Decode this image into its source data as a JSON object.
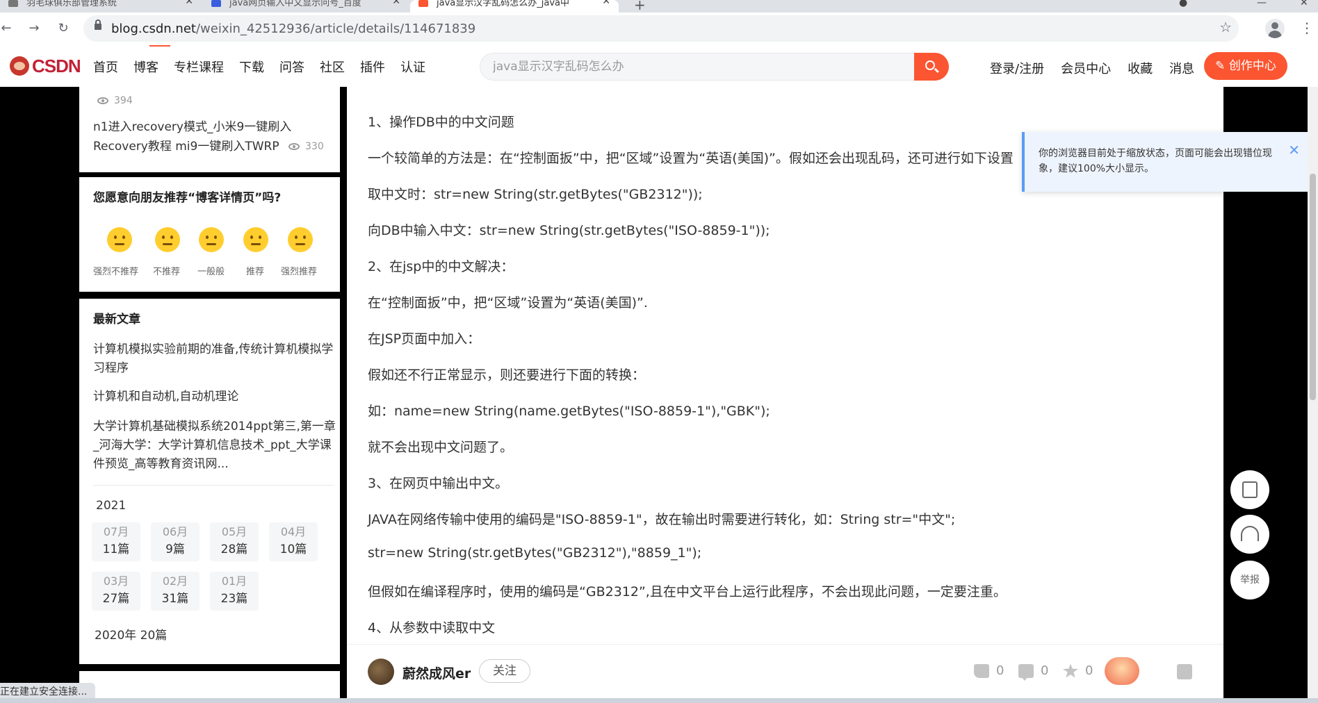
{
  "browser": {
    "tabs": [
      {
        "title": "羽毛球俱乐部管理系统",
        "color": "#5f6368"
      },
      {
        "title": "java网页输入中文显示问号_百度",
        "color": "#3a5de0"
      },
      {
        "title": "java显示汉字乱码怎么办_java中",
        "color": "#fc5531"
      }
    ],
    "url_domain": "blog.csdn.net",
    "url_path": "/weixin_42512936/article/details/114671839"
  },
  "header": {
    "logo": "CSDN",
    "nav": [
      "首页",
      "博客",
      "专栏课程",
      "下载",
      "问答",
      "社区",
      "插件",
      "认证"
    ],
    "search_placeholder": "java显示汉字乱码怎么办",
    "right_nav": [
      "登录/注册",
      "会员中心",
      "收藏",
      "消息"
    ],
    "create_label": "创作中心"
  },
  "sidebar": {
    "top_card": {
      "views_1": "394",
      "link_2": "n1进入recovery模式_小米9一键刷入Recovery教程 mi9一键刷入TWRP",
      "views_2": "330"
    },
    "rating": {
      "question": "您愿意向朋友推荐“博客详情页”吗?",
      "options": [
        "强烈不推荐",
        "不推荐",
        "一般般",
        "推荐",
        "强烈推荐"
      ]
    },
    "recent": {
      "heading": "最新文章",
      "articles": [
        "计算机模拟实验前期的准备,传统计算机模拟学习程序",
        "计算机和自动机,自动机理论",
        "大学计算机基础模拟系统2014ppt第三,第一章_河海大学：大学计算机信息技术_ppt_大学课件预览_高等教育资讯网..."
      ],
      "year": "2021",
      "months": [
        {
          "month": "07月",
          "count": "11篇"
        },
        {
          "month": "06月",
          "count": "9篇"
        },
        {
          "month": "05月",
          "count": "28篇"
        },
        {
          "month": "04月",
          "count": "10篇"
        },
        {
          "month": "03月",
          "count": "27篇"
        },
        {
          "month": "02月",
          "count": "31篇"
        },
        {
          "month": "01月",
          "count": "23篇"
        }
      ],
      "year_2020": "2020年  20篇"
    }
  },
  "article": {
    "paragraphs": [
      "1、操作DB中的中文问题",
      "一个较简单的方法是：在“控制面扳”中，把“区域”设置为“英语(美国)”。假如还会出现乱码，还可进行如下设置",
      "取中文时：str=new String(str.getBytes(\"GB2312\"));",
      "向DB中输入中文：str=new String(str.getBytes(\"ISO-8859-1\"));",
      "2、在jsp中的中文解决：",
      "在“控制面扳”中，把“区域”设置为“英语(美国)”.",
      "在JSP页面中加入：",
      "假如还不行正常显示，则还要进行下面的转换：",
      "如：name=new String(name.getBytes(\"ISO-8859-1\"),\"GBK\");",
      "就不会出现中文问题了。",
      "3、在网页中输出中文。",
      "JAVA在网络传输中使用的编码是\"ISO-8859-1\"，故在输出时需要进行转化，如：String str=\"中文\";",
      "str=new String(str.getBytes(\"GB2312\"),\"8859_1\");",
      "但假如在编译程序时，使用的编码是“GB2312”,且在中文平台上运行此程序，不会出现此问题，一定要注重。",
      "4、从参数中读取中文"
    ],
    "author": "蔚然成风er",
    "follow_label": "关注",
    "likes": "0",
    "comments": "0",
    "favorites": "0"
  },
  "notice": {
    "text": "你的浏览器目前处于缩放状态，页面可能会出现错位现象，建议100%大小显示。"
  },
  "floating": {
    "report_label": "举报"
  },
  "status": "正在建立安全连接..."
}
